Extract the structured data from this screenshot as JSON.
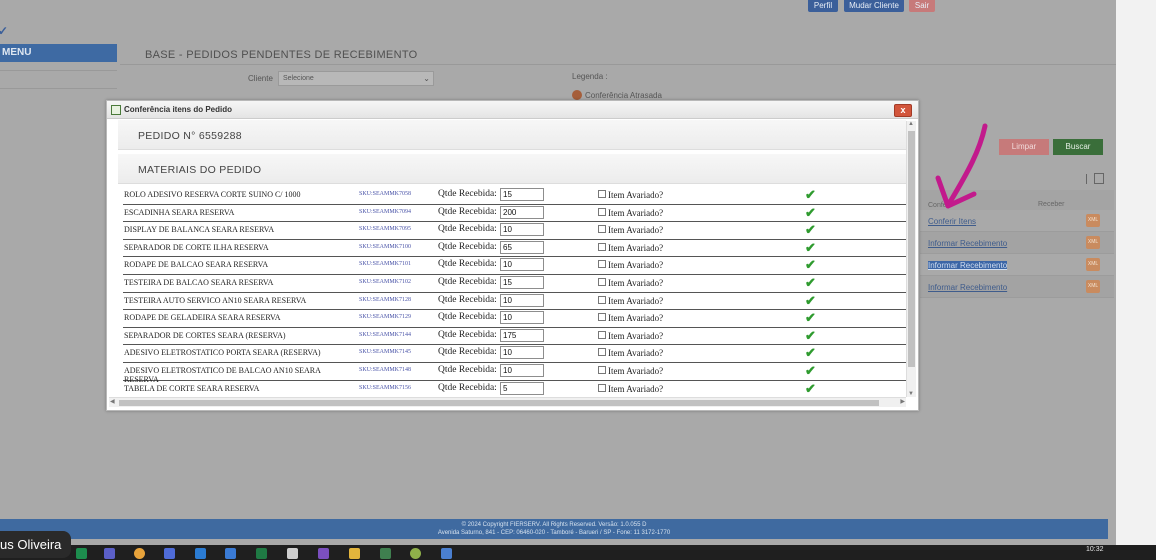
{
  "header": {
    "perfil": "Perfil",
    "mudar_cliente": "Mudar Cliente",
    "sair": "Sair"
  },
  "menu": {
    "label": "MENU"
  },
  "page": {
    "title": "BASE - PEDIDOS PENDENTES DE RECEBIMENTO"
  },
  "filters": {
    "cliente_label": "Cliente",
    "cliente_value": "Selecione",
    "limpar": "Limpar",
    "buscar": "Buscar"
  },
  "legenda": {
    "label": "Legenda :",
    "atrasada": "Conferência Atrasada"
  },
  "results": {
    "col_1": "Conferir",
    "col_2": "Receber",
    "rows": [
      {
        "link": "Conferir Itens",
        "action": "XML",
        "selected": false
      },
      {
        "link": "Informar Recebimento",
        "action": "XML",
        "selected": false
      },
      {
        "link": "Informar Recebimento",
        "action": "XML",
        "selected": true
      },
      {
        "link": "Informar Recebimento",
        "action": "XML",
        "selected": false
      }
    ]
  },
  "footer": {
    "line1": "© 2024 Copyright FIERSERV. All Rights Reserved. Versão: 1.0.055 D",
    "line2": "Avenida Saturno, 841 - CEP: 06460-020 - Tamboré - Barueri / SP - Fone: 11 3172-1770"
  },
  "modal": {
    "title": "Conferência itens do Pedido",
    "close": "x",
    "pedido_heading": "PEDIDO N° 6559288",
    "materiais_heading": "MATERIAIS DO PEDIDO",
    "qtde_label": "Qtde Recebida:",
    "avariado_label": "Item Avariado?",
    "items": [
      {
        "desc": "ROLO ADESIVO RESERVA CORTE SUINO C/ 1000",
        "sku": "SKU:SEAMMK7058",
        "qty": "15"
      },
      {
        "desc": "ESCADINHA SEARA RESERVA",
        "sku": "SKU:SEAMMK7094",
        "qty": "200"
      },
      {
        "desc": "DISPLAY DE BALANCA SEARA RESERVA",
        "sku": "SKU:SEAMMK7095",
        "qty": "10"
      },
      {
        "desc": "SEPARADOR DE CORTE ILHA RESERVA",
        "sku": "SKU:SEAMMK7100",
        "qty": "65"
      },
      {
        "desc": "RODAPE DE BALCAO SEARA RESERVA",
        "sku": "SKU:SEAMMK7101",
        "qty": "10"
      },
      {
        "desc": "TESTEIRA DE BALCAO SEARA RESERVA",
        "sku": "SKU:SEAMMK7102",
        "qty": "15"
      },
      {
        "desc": "TESTEIRA AUTO SERVICO AN10 SEARA RESERVA",
        "sku": "SKU:SEAMMK7128",
        "qty": "10"
      },
      {
        "desc": "RODAPE DE GELADEIRA SEARA RESERVA",
        "sku": "SKU:SEAMMK7129",
        "qty": "10"
      },
      {
        "desc": "SEPARADOR DE CORTES SEARA (RESERVA)",
        "sku": "SKU:SEAMMK7144",
        "qty": "175"
      },
      {
        "desc": "ADESIVO ELETROSTATICO PORTA SEARA (RESERVA)",
        "sku": "SKU:SEAMMK7145",
        "qty": "10"
      },
      {
        "desc": "ADESIVO ELETROSTATICO DE BALCAO AN10 SEARA RESERVA",
        "sku": "SKU:SEAMMK7148",
        "qty": "10"
      },
      {
        "desc": "TABELA DE CORTE SEARA RESERVA",
        "sku": "SKU:SEAMMK7156",
        "qty": "5"
      }
    ]
  },
  "taskbar": {
    "time": "10:32"
  },
  "presenter": {
    "name": "us Oliveira"
  },
  "colors": {
    "accent": "#3e6aa3",
    "annotation_arrow": "#c21a8c",
    "ok_check": "#2f9b2f"
  }
}
